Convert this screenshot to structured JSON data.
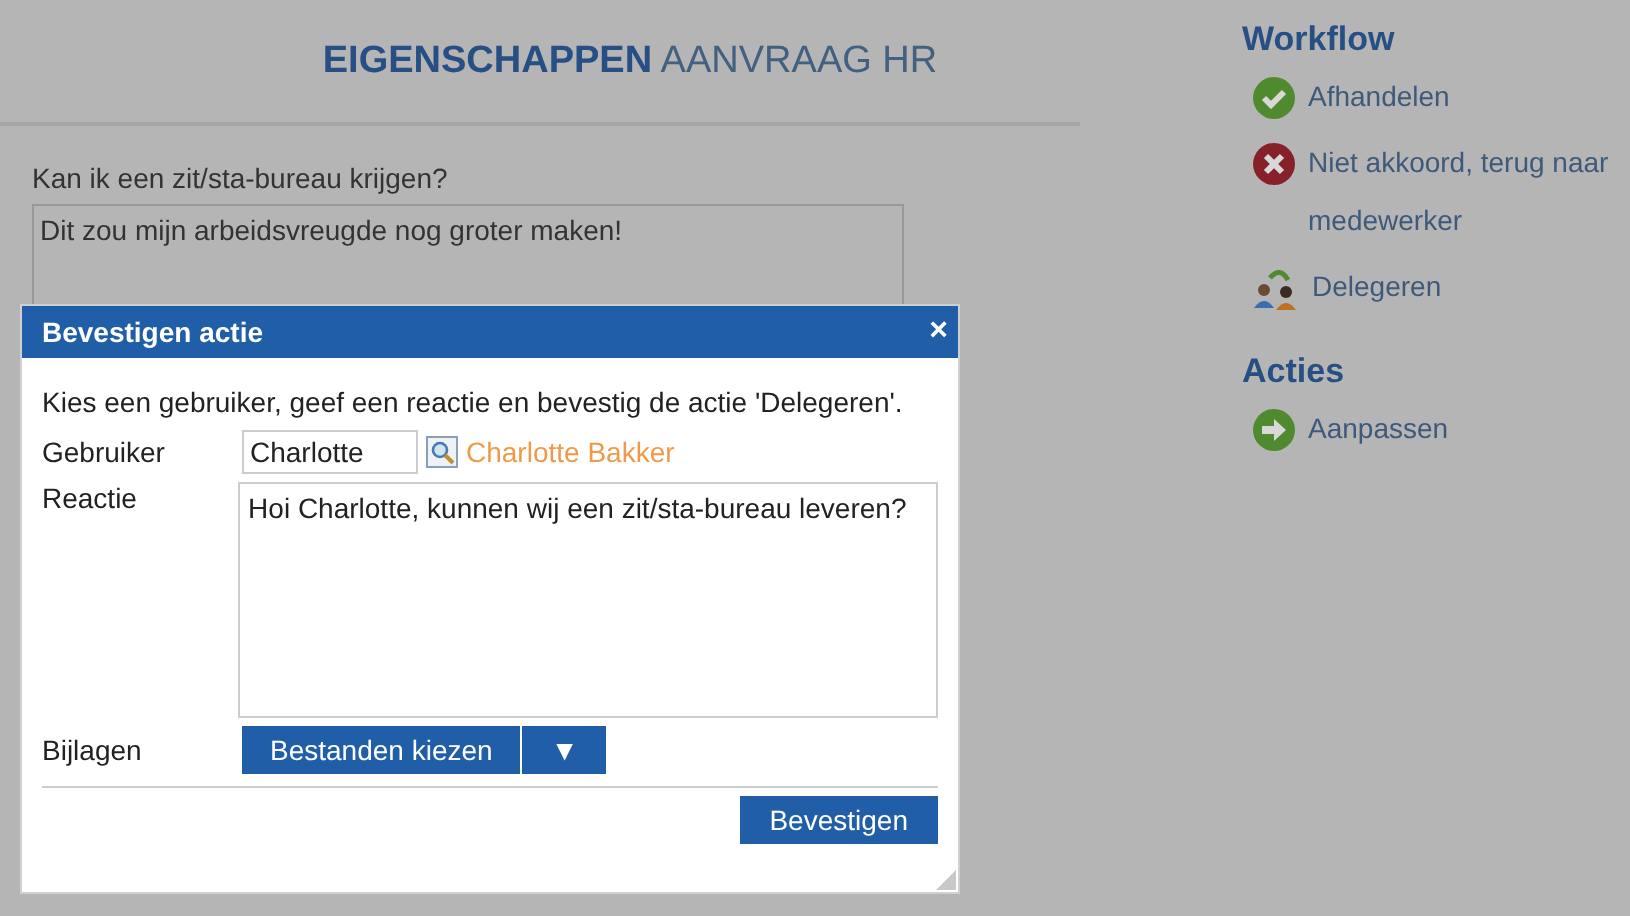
{
  "page": {
    "title_bold": "EIGENSCHAPPEN",
    "title_rest": "AANVRAAG HR",
    "question": "Kan ik een zit/sta-bureau krijgen?",
    "answer": "Dit zou mijn arbeidsvreugde nog groter maken!"
  },
  "sidebar": [
    {
      "heading": "Workflow",
      "items": [
        {
          "kind": "check",
          "label": "Afhandelen"
        },
        {
          "kind": "cross",
          "label": "Niet akkoord, terug naar medewerker"
        },
        {
          "kind": "delegate",
          "label": "Delegeren"
        }
      ]
    },
    {
      "heading": "Acties",
      "items": [
        {
          "kind": "arrow",
          "label": "Aanpassen"
        }
      ]
    }
  ],
  "dialog": {
    "title": "Bevestigen actie",
    "close": "×",
    "intro": "Kies een gebruiker, geef een reactie en bevestig de actie 'Delegeren'.",
    "user_label": "Gebruiker",
    "user_value": "Charlotte",
    "user_name": "Charlotte Bakker",
    "reaction_label": "Reactie",
    "reaction_value": "Hoi Charlotte, kunnen wij een zit/sta-bureau leveren?",
    "attach_label": "Bijlagen",
    "choose_button": "Bestanden kiezen",
    "dropdown": "▼",
    "confirm_button": "Bevestigen"
  }
}
